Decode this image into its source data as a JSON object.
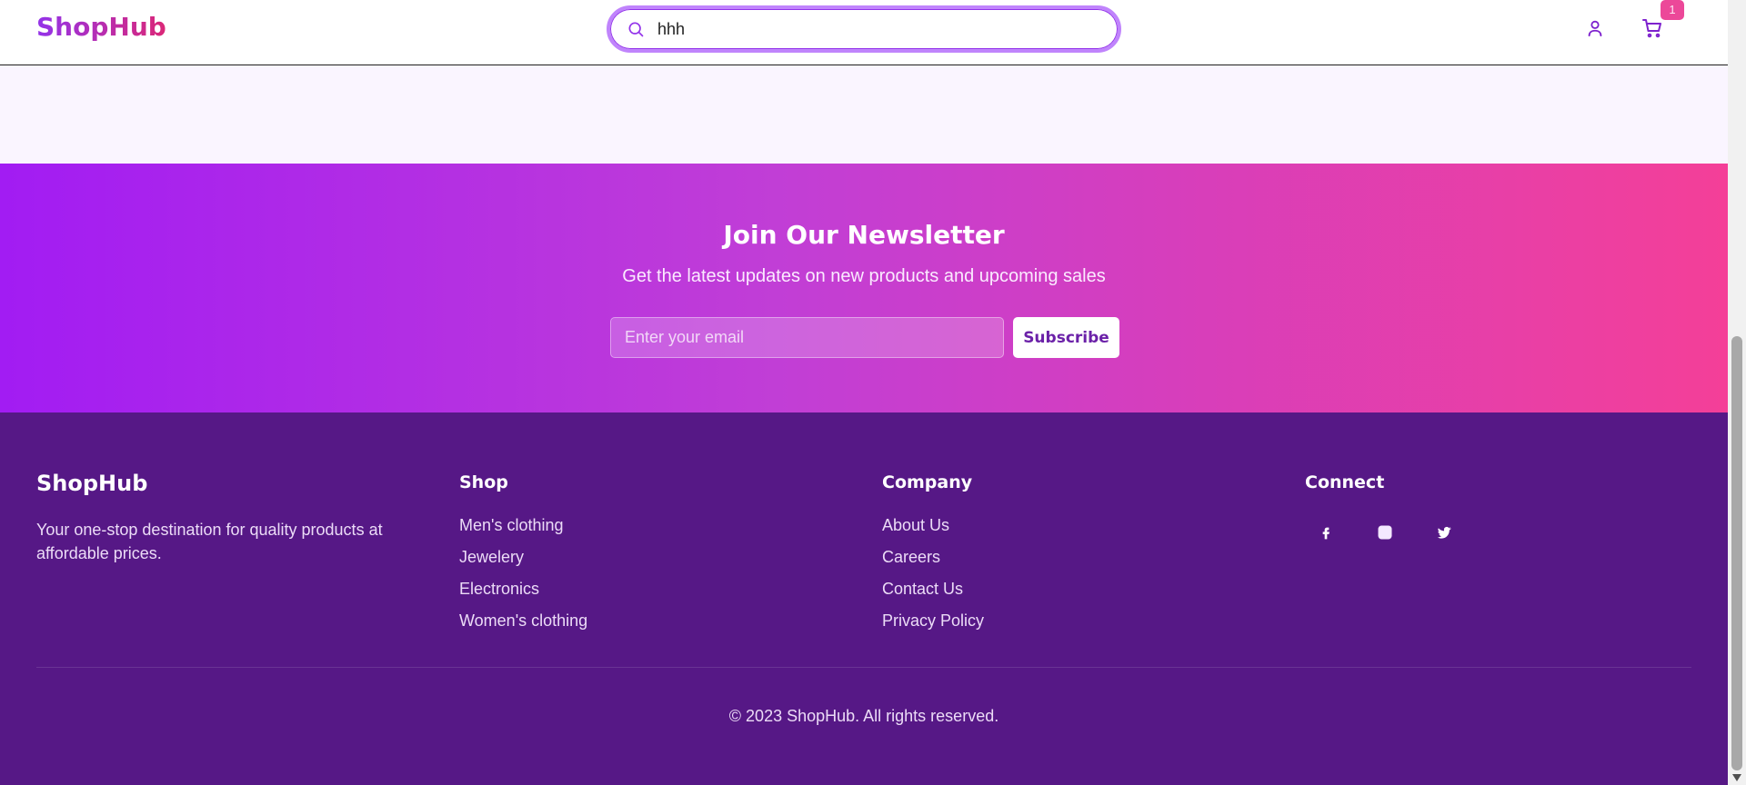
{
  "header": {
    "logo": "ShopHub",
    "search_value": "hhh",
    "cart_count": "1"
  },
  "newsletter": {
    "title": "Join Our Newsletter",
    "subtitle": "Get the latest updates on new products and upcoming sales",
    "email_placeholder": "Enter your email",
    "button_label": "Subscribe"
  },
  "footer": {
    "brand": "ShopHub",
    "tagline": "Your one-stop destination for quality products at affordable prices.",
    "columns": [
      {
        "heading": "Shop",
        "items": [
          "Men's clothing",
          "Jewelery",
          "Electronics",
          "Women's clothing"
        ]
      },
      {
        "heading": "Company",
        "items": [
          "About Us",
          "Careers",
          "Contact Us",
          "Privacy Policy"
        ]
      },
      {
        "heading": "Connect",
        "icons": [
          "facebook-icon",
          "instagram-icon",
          "twitter-icon"
        ]
      }
    ],
    "copyright": "© 2023 ShopHub. All rights reserved."
  },
  "colors": {
    "brand_purple": "#9333ea",
    "brand_pink": "#ec4899",
    "footer_bg": "#561886"
  }
}
